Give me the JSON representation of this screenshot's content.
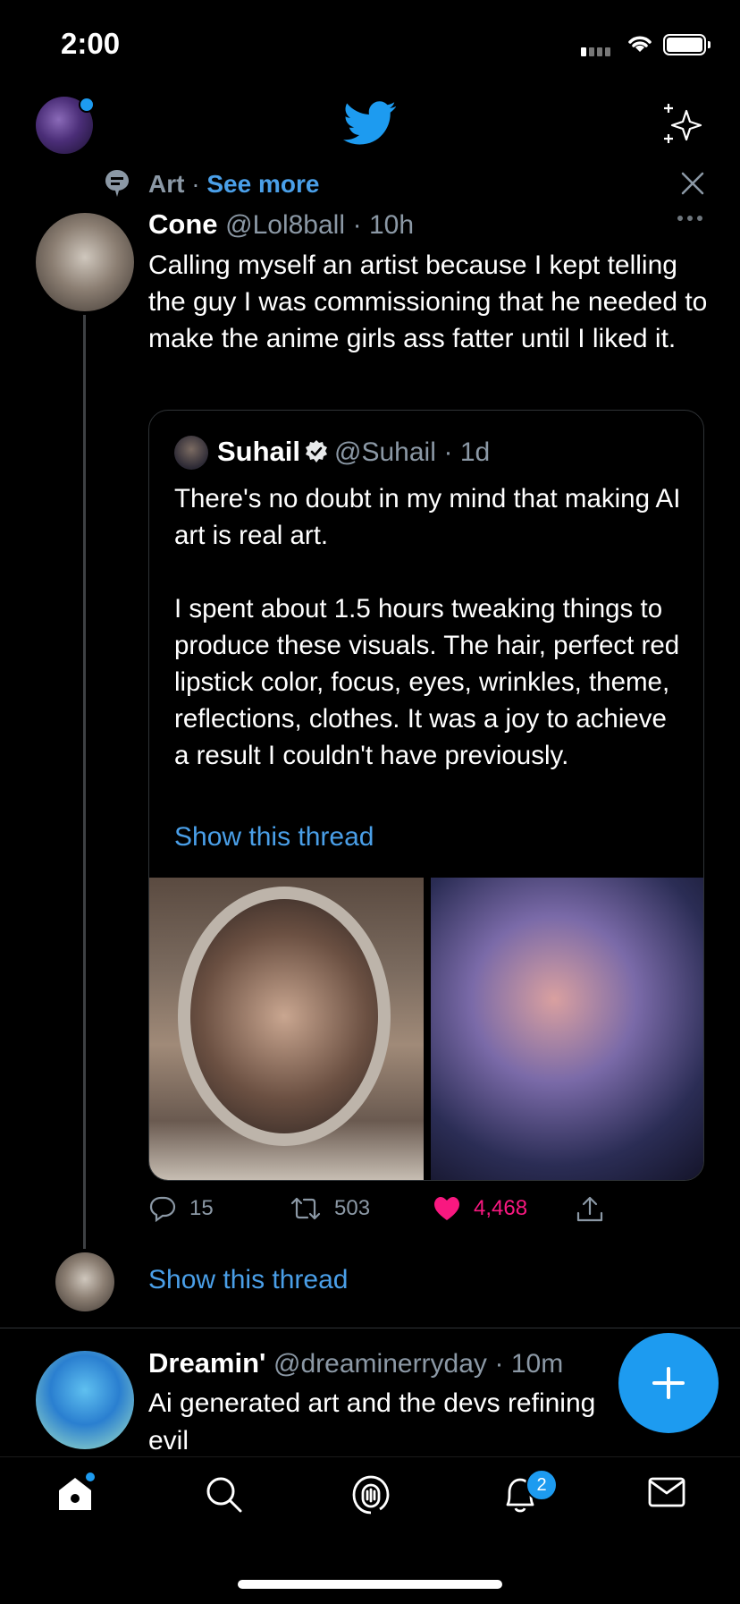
{
  "status_bar": {
    "time": "2:00"
  },
  "context": {
    "topic": "Art",
    "separator": "·",
    "action": "See more"
  },
  "tweet": {
    "name": "Cone",
    "handle": "@Lol8ball",
    "time": "· 10h",
    "text": "Calling myself an artist because I kept telling the guy I was commissioning that he needed to make the anime girls ass fatter until I liked it."
  },
  "quote": {
    "name": "Suhail",
    "handle": "@Suhail",
    "time": "· 1d",
    "text": "There's no doubt in my mind that making AI art is real art.\n\nI spent about 1.5 hours tweaking things to produce these visuals. The hair, perfect red lipstick color, focus, eyes, wrinkles, theme, reflections, clothes. It was a joy to achieve a result I couldn't have previously.",
    "show_thread": "Show this thread"
  },
  "actions": {
    "replies": "15",
    "retweets": "503",
    "likes": "4,468"
  },
  "show_thread": "Show this thread",
  "tweet2": {
    "name": "Dreamin'",
    "handle": "@dreaminerryday",
    "time": "· 10m",
    "text": "Ai generated art and the devs refining evil"
  },
  "tabbar": {
    "notifications_badge": "2"
  },
  "colors": {
    "accent": "#1d9bf0",
    "like": "#f91880",
    "link": "#4a9fe8",
    "muted": "#8b98a5"
  }
}
